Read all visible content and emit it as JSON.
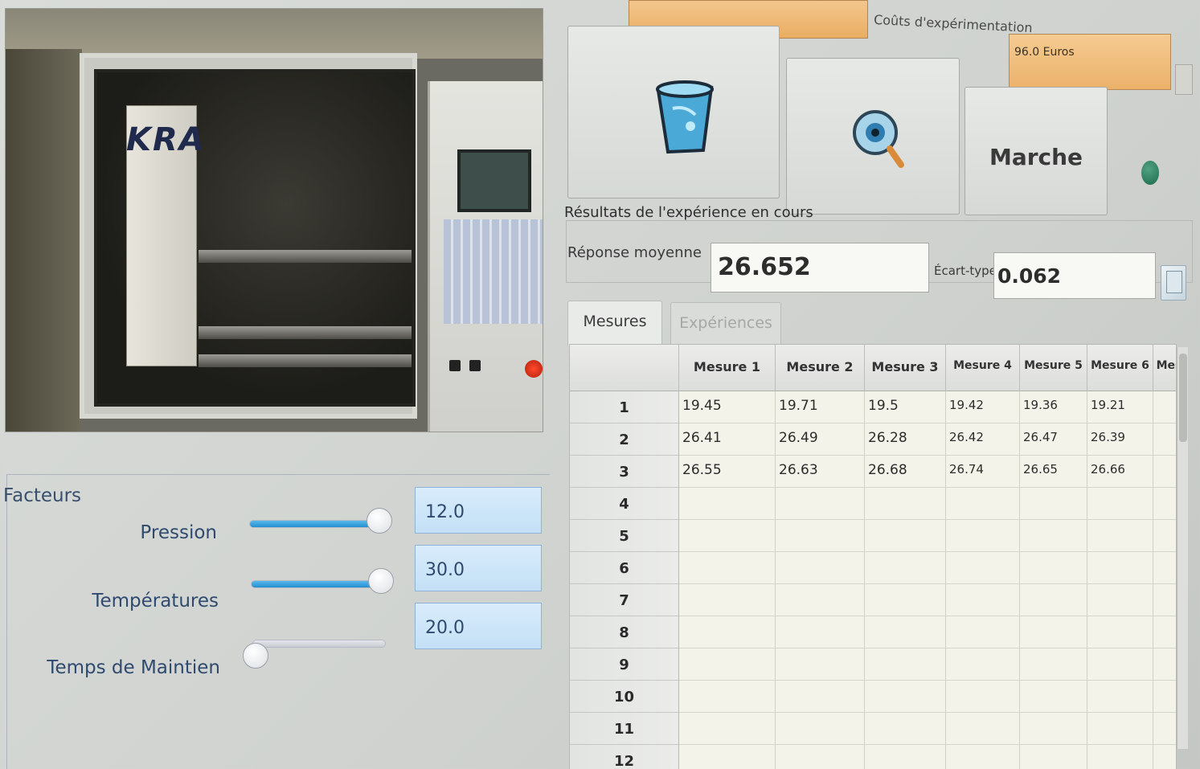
{
  "photo": {
    "brand_text": "KRA"
  },
  "factors": {
    "title": "Facteurs",
    "items": [
      {
        "label": "Pression",
        "value": "12.0",
        "slider_fraction": 1.0
      },
      {
        "label": "Températures",
        "value": "30.0",
        "slider_fraction": 1.0
      },
      {
        "label": "Temps de Maintien",
        "value": "20.0",
        "slider_fraction": 0.0
      }
    ]
  },
  "header": {
    "cost_label": "Coûts d'expérimentation",
    "cost_value": "96.0 Euros"
  },
  "toolbar": {
    "clear_icon": "trash-bin-icon",
    "inspect_icon": "eye-magnifier-icon",
    "run_label": "Marche",
    "status_color": "#1f6a4d"
  },
  "results": {
    "title": "Résultats de l'expérience en cours",
    "mean_label": "Réponse moyenne",
    "mean_value": "26.652",
    "std_label": "Écart-type",
    "std_value": "0.062"
  },
  "tabs": [
    {
      "label": "Mesures",
      "active": true
    },
    {
      "label": "Expériences",
      "active": false
    }
  ],
  "table": {
    "columns": [
      "Mesure 1",
      "Mesure 2",
      "Mesure 3",
      "Mesure 4",
      "Mesure 5",
      "Mesure 6",
      "Mes"
    ],
    "row_labels": [
      "1",
      "2",
      "3",
      "4",
      "5",
      "6",
      "7",
      "8",
      "9",
      "10",
      "11",
      "12"
    ],
    "rows": [
      [
        "19.45",
        "19.71",
        "19.5",
        "19.42",
        "19.36",
        "19.21",
        ""
      ],
      [
        "26.41",
        "26.49",
        "26.28",
        "26.42",
        "26.47",
        "26.39",
        ""
      ],
      [
        "26.55",
        "26.63",
        "26.68",
        "26.74",
        "26.65",
        "26.66",
        ""
      ]
    ]
  }
}
